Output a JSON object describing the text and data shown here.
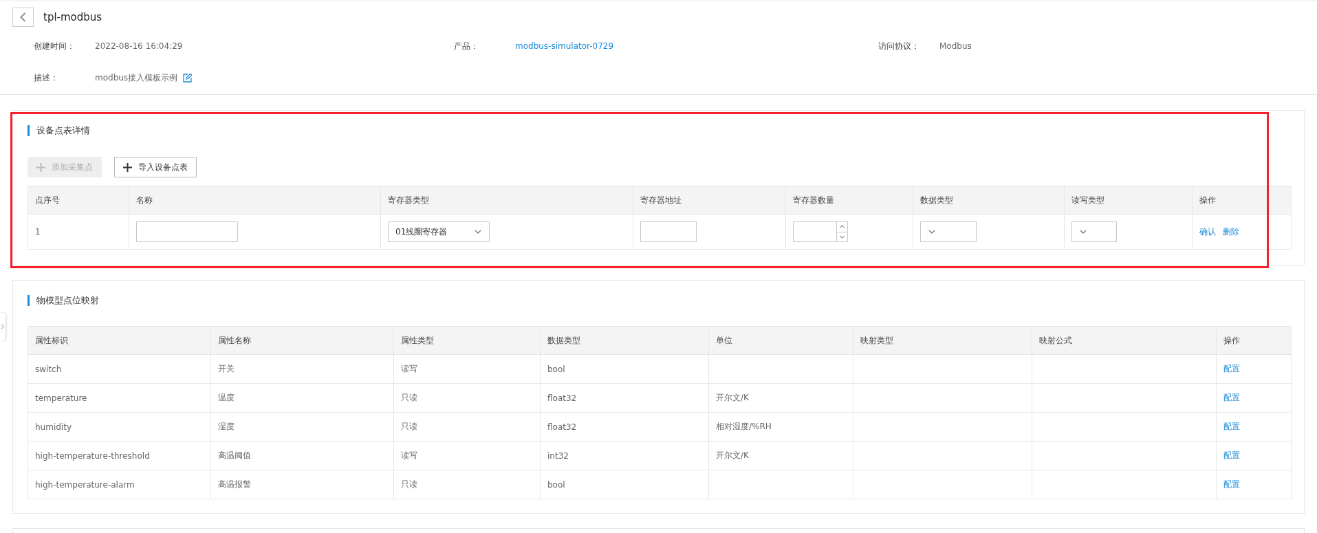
{
  "header": {
    "title": "tpl-modbus",
    "fields": [
      {
        "label": "创建时间：",
        "value": "2022-08-16 16:04:29",
        "kind": "text"
      },
      {
        "label": "产品：",
        "value": "modbus-simulator-0729",
        "kind": "link"
      },
      {
        "label": "访问协议：",
        "value": "Modbus",
        "kind": "text"
      }
    ],
    "description": {
      "label": "描述：",
      "value": "modbus接入模板示例"
    }
  },
  "point_table": {
    "title": "设备点表详情",
    "highlighted": true,
    "buttons": [
      {
        "label": "添加采集点",
        "disabled": true
      },
      {
        "label": "导入设备点表",
        "disabled": false
      }
    ],
    "columns": [
      "点序号",
      "名称",
      "寄存器类型",
      "寄存器地址",
      "寄存器数量",
      "数据类型",
      "读写类型",
      "操作"
    ],
    "rows": [
      [
        {
          "kind": "text",
          "value": "1"
        },
        {
          "kind": "input"
        },
        {
          "kind": "select",
          "value": "01线圈寄存器"
        },
        {
          "kind": "input"
        },
        {
          "kind": "number"
        },
        {
          "kind": "select"
        },
        {
          "kind": "select"
        },
        {
          "kind": "actions",
          "links": [
            "确认",
            "删除"
          ]
        }
      ]
    ]
  },
  "mapping": {
    "title": "物模型点位映射",
    "columns": [
      "属性标识",
      "属性名称",
      "属性类型",
      "数据类型",
      "单位",
      "映射类型",
      "映射公式",
      "操作"
    ],
    "rows": [
      {
        "id": "switch",
        "name": "开关",
        "access": "读写",
        "data_type": "bool",
        "unit": "",
        "action": "配置"
      },
      {
        "id": "temperature",
        "name": "温度",
        "access": "只读",
        "data_type": "float32",
        "unit": "开尔文/K",
        "action": "配置"
      },
      {
        "id": "humidity",
        "name": "湿度",
        "access": "只读",
        "data_type": "float32",
        "unit": "相对湿度/%RH",
        "action": "配置"
      },
      {
        "id": "high-temperature-threshold",
        "name": "高温阈值",
        "access": "读写",
        "data_type": "int32",
        "unit": "开尔文/K",
        "action": "配置"
      },
      {
        "id": "high-temperature-alarm",
        "name": "高温报警",
        "access": "只读",
        "data_type": "bool",
        "unit": "",
        "action": "配置"
      }
    ]
  }
}
